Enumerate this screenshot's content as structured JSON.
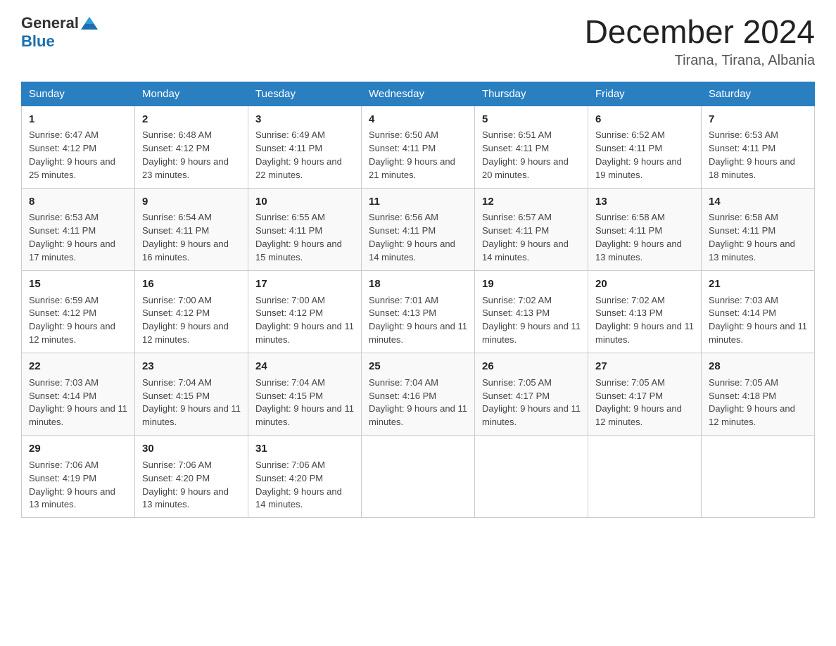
{
  "header": {
    "logo_general": "General",
    "logo_blue": "Blue",
    "month_year": "December 2024",
    "location": "Tirana, Tirana, Albania"
  },
  "weekdays": [
    "Sunday",
    "Monday",
    "Tuesday",
    "Wednesday",
    "Thursday",
    "Friday",
    "Saturday"
  ],
  "weeks": [
    [
      {
        "day": "1",
        "sunrise": "Sunrise: 6:47 AM",
        "sunset": "Sunset: 4:12 PM",
        "daylight": "Daylight: 9 hours and 25 minutes."
      },
      {
        "day": "2",
        "sunrise": "Sunrise: 6:48 AM",
        "sunset": "Sunset: 4:12 PM",
        "daylight": "Daylight: 9 hours and 23 minutes."
      },
      {
        "day": "3",
        "sunrise": "Sunrise: 6:49 AM",
        "sunset": "Sunset: 4:11 PM",
        "daylight": "Daylight: 9 hours and 22 minutes."
      },
      {
        "day": "4",
        "sunrise": "Sunrise: 6:50 AM",
        "sunset": "Sunset: 4:11 PM",
        "daylight": "Daylight: 9 hours and 21 minutes."
      },
      {
        "day": "5",
        "sunrise": "Sunrise: 6:51 AM",
        "sunset": "Sunset: 4:11 PM",
        "daylight": "Daylight: 9 hours and 20 minutes."
      },
      {
        "day": "6",
        "sunrise": "Sunrise: 6:52 AM",
        "sunset": "Sunset: 4:11 PM",
        "daylight": "Daylight: 9 hours and 19 minutes."
      },
      {
        "day": "7",
        "sunrise": "Sunrise: 6:53 AM",
        "sunset": "Sunset: 4:11 PM",
        "daylight": "Daylight: 9 hours and 18 minutes."
      }
    ],
    [
      {
        "day": "8",
        "sunrise": "Sunrise: 6:53 AM",
        "sunset": "Sunset: 4:11 PM",
        "daylight": "Daylight: 9 hours and 17 minutes."
      },
      {
        "day": "9",
        "sunrise": "Sunrise: 6:54 AM",
        "sunset": "Sunset: 4:11 PM",
        "daylight": "Daylight: 9 hours and 16 minutes."
      },
      {
        "day": "10",
        "sunrise": "Sunrise: 6:55 AM",
        "sunset": "Sunset: 4:11 PM",
        "daylight": "Daylight: 9 hours and 15 minutes."
      },
      {
        "day": "11",
        "sunrise": "Sunrise: 6:56 AM",
        "sunset": "Sunset: 4:11 PM",
        "daylight": "Daylight: 9 hours and 14 minutes."
      },
      {
        "day": "12",
        "sunrise": "Sunrise: 6:57 AM",
        "sunset": "Sunset: 4:11 PM",
        "daylight": "Daylight: 9 hours and 14 minutes."
      },
      {
        "day": "13",
        "sunrise": "Sunrise: 6:58 AM",
        "sunset": "Sunset: 4:11 PM",
        "daylight": "Daylight: 9 hours and 13 minutes."
      },
      {
        "day": "14",
        "sunrise": "Sunrise: 6:58 AM",
        "sunset": "Sunset: 4:11 PM",
        "daylight": "Daylight: 9 hours and 13 minutes."
      }
    ],
    [
      {
        "day": "15",
        "sunrise": "Sunrise: 6:59 AM",
        "sunset": "Sunset: 4:12 PM",
        "daylight": "Daylight: 9 hours and 12 minutes."
      },
      {
        "day": "16",
        "sunrise": "Sunrise: 7:00 AM",
        "sunset": "Sunset: 4:12 PM",
        "daylight": "Daylight: 9 hours and 12 minutes."
      },
      {
        "day": "17",
        "sunrise": "Sunrise: 7:00 AM",
        "sunset": "Sunset: 4:12 PM",
        "daylight": "Daylight: 9 hours and 11 minutes."
      },
      {
        "day": "18",
        "sunrise": "Sunrise: 7:01 AM",
        "sunset": "Sunset: 4:13 PM",
        "daylight": "Daylight: 9 hours and 11 minutes."
      },
      {
        "day": "19",
        "sunrise": "Sunrise: 7:02 AM",
        "sunset": "Sunset: 4:13 PM",
        "daylight": "Daylight: 9 hours and 11 minutes."
      },
      {
        "day": "20",
        "sunrise": "Sunrise: 7:02 AM",
        "sunset": "Sunset: 4:13 PM",
        "daylight": "Daylight: 9 hours and 11 minutes."
      },
      {
        "day": "21",
        "sunrise": "Sunrise: 7:03 AM",
        "sunset": "Sunset: 4:14 PM",
        "daylight": "Daylight: 9 hours and 11 minutes."
      }
    ],
    [
      {
        "day": "22",
        "sunrise": "Sunrise: 7:03 AM",
        "sunset": "Sunset: 4:14 PM",
        "daylight": "Daylight: 9 hours and 11 minutes."
      },
      {
        "day": "23",
        "sunrise": "Sunrise: 7:04 AM",
        "sunset": "Sunset: 4:15 PM",
        "daylight": "Daylight: 9 hours and 11 minutes."
      },
      {
        "day": "24",
        "sunrise": "Sunrise: 7:04 AM",
        "sunset": "Sunset: 4:15 PM",
        "daylight": "Daylight: 9 hours and 11 minutes."
      },
      {
        "day": "25",
        "sunrise": "Sunrise: 7:04 AM",
        "sunset": "Sunset: 4:16 PM",
        "daylight": "Daylight: 9 hours and 11 minutes."
      },
      {
        "day": "26",
        "sunrise": "Sunrise: 7:05 AM",
        "sunset": "Sunset: 4:17 PM",
        "daylight": "Daylight: 9 hours and 11 minutes."
      },
      {
        "day": "27",
        "sunrise": "Sunrise: 7:05 AM",
        "sunset": "Sunset: 4:17 PM",
        "daylight": "Daylight: 9 hours and 12 minutes."
      },
      {
        "day": "28",
        "sunrise": "Sunrise: 7:05 AM",
        "sunset": "Sunset: 4:18 PM",
        "daylight": "Daylight: 9 hours and 12 minutes."
      }
    ],
    [
      {
        "day": "29",
        "sunrise": "Sunrise: 7:06 AM",
        "sunset": "Sunset: 4:19 PM",
        "daylight": "Daylight: 9 hours and 13 minutes."
      },
      {
        "day": "30",
        "sunrise": "Sunrise: 7:06 AM",
        "sunset": "Sunset: 4:20 PM",
        "daylight": "Daylight: 9 hours and 13 minutes."
      },
      {
        "day": "31",
        "sunrise": "Sunrise: 7:06 AM",
        "sunset": "Sunset: 4:20 PM",
        "daylight": "Daylight: 9 hours and 14 minutes."
      },
      null,
      null,
      null,
      null
    ]
  ]
}
